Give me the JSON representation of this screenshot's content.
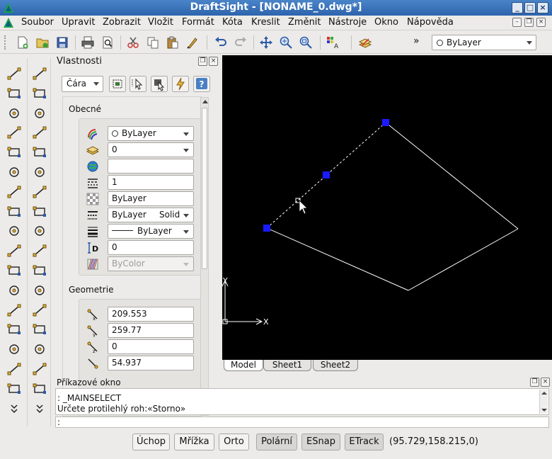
{
  "window": {
    "title": "DraftSight - [NONAME_0.dwg*]"
  },
  "menu": [
    "Soubor",
    "Upravit",
    "Zobrazit",
    "Vložit",
    "Formát",
    "Kóta",
    "Kreslit",
    "Změnit",
    "Nástroje",
    "Okno",
    "Nápověda"
  ],
  "toolbar": {
    "overflow": "»",
    "layer_combo": "ByLayer"
  },
  "properties": {
    "title": "Vlastnosti",
    "entity_type": "Čára",
    "general_header": "Obecné",
    "general": [
      {
        "icon": "color-icon",
        "value": "ByLayer",
        "type": "combo"
      },
      {
        "icon": "layer-icon",
        "value": "0",
        "type": "combo"
      },
      {
        "icon": "hyperlink-icon",
        "value": "",
        "type": "text"
      },
      {
        "icon": "linetype-scale-icon",
        "value": "1",
        "type": "text"
      },
      {
        "icon": "transparency-icon",
        "value": "ByLayer",
        "type": "text"
      },
      {
        "icon": "linestyle-icon",
        "value": "ByLayer",
        "value2": "Solid",
        "type": "combo"
      },
      {
        "icon": "lineweight-icon",
        "value": "ByLayer",
        "type": "combo"
      },
      {
        "icon": "thickness-icon",
        "value": "0",
        "type": "text"
      },
      {
        "icon": "plotstyle-icon",
        "value": "ByColor",
        "type": "combo-disabled"
      }
    ],
    "geometry_header": "Geometrie",
    "geometry": [
      {
        "icon": "start-x-icon",
        "value": "209.553"
      },
      {
        "icon": "start-y-icon",
        "value": "259.77"
      },
      {
        "icon": "start-z-icon",
        "value": "0"
      },
      {
        "icon": "end-x-icon",
        "value": "54.937"
      }
    ]
  },
  "sheet_tabs": [
    "Model",
    "Sheet1",
    "Sheet2"
  ],
  "command_window": {
    "title": "Příkazové okno",
    "lines": [
      ": _MAINSELECT",
      "Určete protilehlý roh:«Storno»"
    ],
    "prompt": ":"
  },
  "status_buttons": [
    {
      "label": "Úchop",
      "on": false
    },
    {
      "label": "Mřížka",
      "on": false
    },
    {
      "label": "Orto",
      "on": false
    },
    {
      "label": "Polární",
      "on": true
    },
    {
      "label": "ESnap",
      "on": true
    },
    {
      "label": "ETrack",
      "on": true
    }
  ],
  "coordinates": "(95.729,158.215,0)",
  "colors": {
    "title_bar": "#2d64ad",
    "canvas": "#000000",
    "grip": "#0000ff"
  }
}
